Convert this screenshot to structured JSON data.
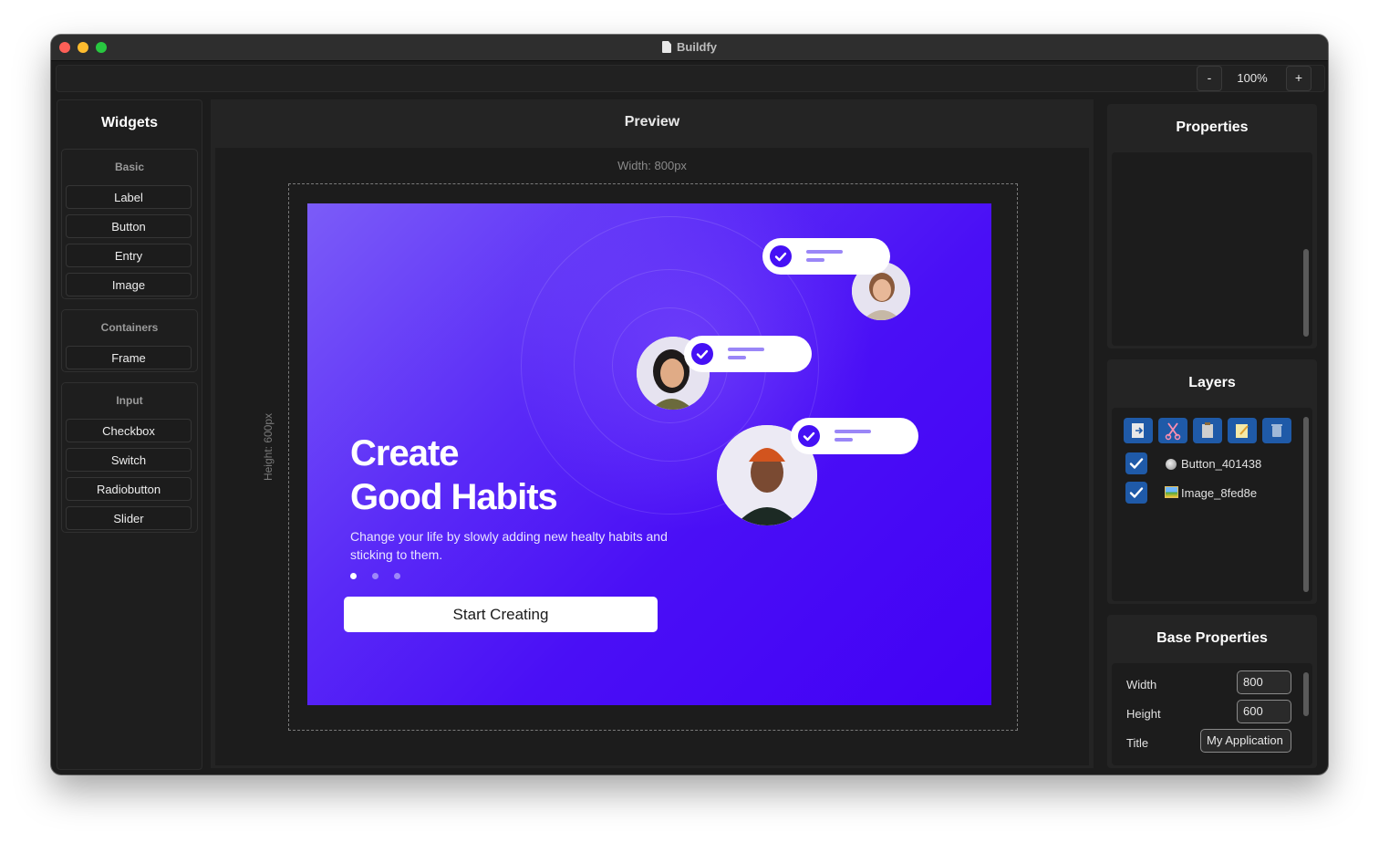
{
  "window": {
    "title": "Buildfy"
  },
  "toolbar": {
    "zoom_out_label": "-",
    "zoom_level": "100%",
    "zoom_in_label": "+"
  },
  "widgets": {
    "heading": "Widgets",
    "sections": [
      {
        "title": "Basic",
        "items": [
          "Label",
          "Button",
          "Entry",
          "Image"
        ]
      },
      {
        "title": "Containers",
        "items": [
          "Frame"
        ]
      },
      {
        "title": "Input",
        "items": [
          "Checkbox",
          "Switch",
          "Radiobutton",
          "Slider"
        ]
      }
    ]
  },
  "preview": {
    "heading": "Preview",
    "width_label": "Width: 800px",
    "height_label": "Height: 600px",
    "app": {
      "title_line1": "Create",
      "title_line2": "Good Habits",
      "subtitle": "Change your life by slowly adding new healty habits and sticking to them.",
      "cta": "Start Creating",
      "accent_color": "#4510f5"
    }
  },
  "properties": {
    "heading": "Properties"
  },
  "layers": {
    "heading": "Layers",
    "tools": [
      "import-icon",
      "scissors-icon",
      "clipboard-icon",
      "edit-icon",
      "trash-icon"
    ],
    "items": [
      {
        "name": "Button_401438",
        "icon": "button-icon",
        "checked": true
      },
      {
        "name": "Image_8fed8e",
        "icon": "image-icon",
        "checked": true
      }
    ]
  },
  "base_properties": {
    "heading": "Base Properties",
    "width_label": "Width",
    "width_value": "800",
    "height_label": "Height",
    "height_value": "600",
    "title_label": "Title",
    "title_value": "My Application"
  }
}
